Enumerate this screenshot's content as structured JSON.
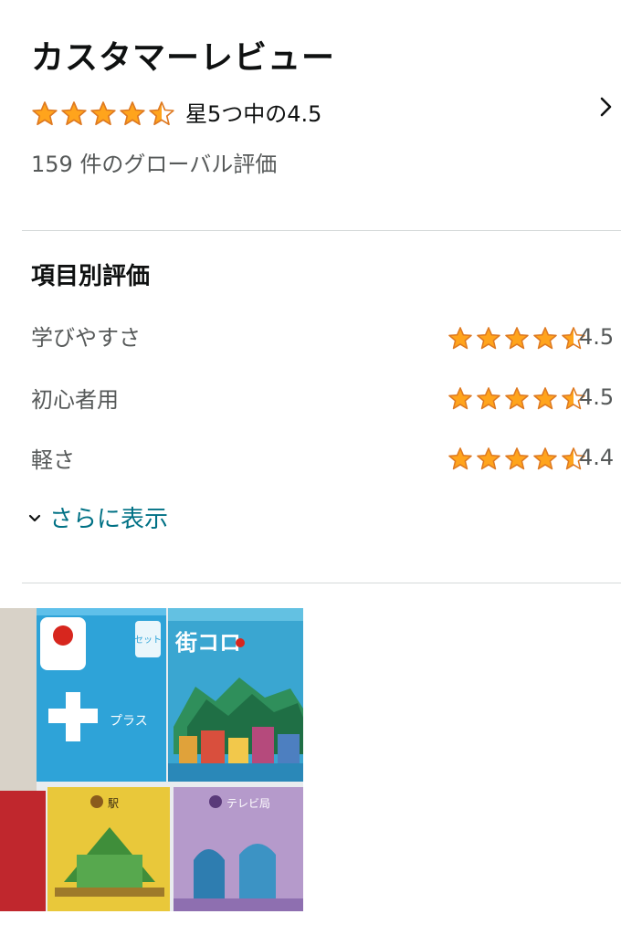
{
  "header": {
    "title": "カスタマーレビュー",
    "overall_rating": 4.5,
    "overall_text": "星5つ中の4.5",
    "global_ratings": "159 件のグローバル評価"
  },
  "feature_ratings": {
    "heading": "項目別評価",
    "items": [
      {
        "label": "学びやすさ",
        "rating": 4.5,
        "value": "4.5"
      },
      {
        "label": "初心者用",
        "rating": 4.5,
        "value": "4.5"
      },
      {
        "label": "軽さ",
        "rating": 4.4,
        "value": "4.4"
      }
    ],
    "see_more": "さらに表示"
  },
  "image": {
    "panel_labels": [
      "セット",
      "街コロ",
      "プラス",
      "駅",
      "テレビ局"
    ]
  },
  "colors": {
    "star_fill": "#FFA41C",
    "star_stroke": "#DE7921",
    "link": "#007185",
    "text_secondary": "#565959"
  }
}
